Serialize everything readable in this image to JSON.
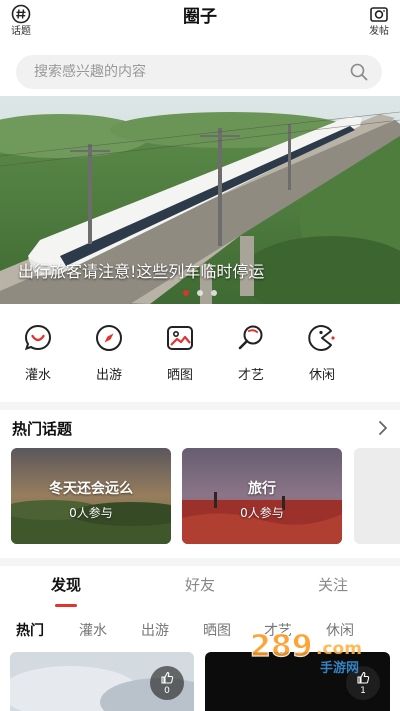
{
  "header": {
    "title": "圈子",
    "left_label": "话题",
    "right_label": "发帖",
    "left_icon": "hash-icon",
    "right_icon": "camera-icon"
  },
  "search": {
    "placeholder": "搜索感兴趣的内容",
    "icon": "search-icon"
  },
  "banner": {
    "caption": "出行旅客请注意!这些列车临时停运",
    "slide_count": 3,
    "active_slide": 1
  },
  "categories": [
    {
      "label": "灌水",
      "icon": "speech-bubble-icon"
    },
    {
      "label": "出游",
      "icon": "compass-icon"
    },
    {
      "label": "晒图",
      "icon": "image-icon"
    },
    {
      "label": "才艺",
      "icon": "ping-pong-paddle-icon"
    },
    {
      "label": "休闲",
      "icon": "pacman-icon"
    }
  ],
  "hot_topics": {
    "title": "热门话题",
    "items": [
      {
        "title": "冬天还会远么",
        "count": "0人参与"
      },
      {
        "title": "旅行",
        "count": "0人参与"
      }
    ]
  },
  "main_tabs": [
    "发现",
    "好友",
    "关注"
  ],
  "active_main_tab": 0,
  "sub_tabs": [
    "热门",
    "灌水",
    "出游",
    "晒图",
    "才艺",
    "休闲"
  ],
  "active_sub_tab": 0,
  "feed": [
    {
      "likes": "0"
    },
    {
      "likes": "1"
    }
  ],
  "watermark": {
    "text": "289",
    "suffix": ".com",
    "sub": "手游网"
  },
  "colors": {
    "accent": "#e5322d",
    "search_bg": "#f1f1f1",
    "separator": "#f5f5f5"
  }
}
